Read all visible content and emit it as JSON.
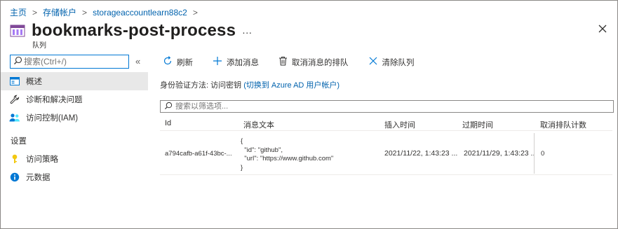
{
  "breadcrumb": {
    "items": [
      "主页",
      "存储帐户",
      "storageaccountlearn88c2"
    ],
    "separator": ">"
  },
  "header": {
    "title": "bookmarks-post-process",
    "more": "···",
    "subtitle": "队列",
    "icon": "queue-icon",
    "close_icon": "close-icon"
  },
  "sidebar": {
    "search_placeholder": "搜索(Ctrl+/)",
    "collapse_label": "«",
    "items": [
      {
        "label": "概述",
        "icon": "overview-icon",
        "active": true
      },
      {
        "label": "诊断和解决问题",
        "icon": "wrench-icon",
        "active": false
      },
      {
        "label": "访问控制(IAM)",
        "icon": "people-icon",
        "active": false
      }
    ],
    "section_label": "设置",
    "settings_items": [
      {
        "label": "访问策略",
        "icon": "key-icon"
      },
      {
        "label": "元数据",
        "icon": "info-icon"
      }
    ]
  },
  "toolbar": {
    "refresh": "刷新",
    "add_message": "添加消息",
    "dequeue": "取消消息的排队",
    "clear_queue": "清除队列"
  },
  "auth": {
    "label": "身份验证方法: 访问密钥",
    "switch_link": "(切换到 Azure AD 用户帐户)"
  },
  "filter": {
    "placeholder": "搜索以筛选项..."
  },
  "table": {
    "headers": [
      "Id",
      "消息文本",
      "插入时间",
      "过期时间",
      "取消排队计数"
    ],
    "rows": [
      {
        "id": "a794cafb-a61f-43bc-...",
        "message": "{\n  \"id\": \"github\",\n  \"url\": \"https://www.github.com\"\n}",
        "inserted": "2021/11/22, 1:43:23 ...",
        "expires": "2021/11/29, 1:43:23 ...",
        "dequeue_count": "0"
      }
    ]
  },
  "colors": {
    "accent": "#0078d4",
    "link": "#0062ad",
    "queue_icon": "#804998",
    "key_icon": "#f2c811"
  }
}
